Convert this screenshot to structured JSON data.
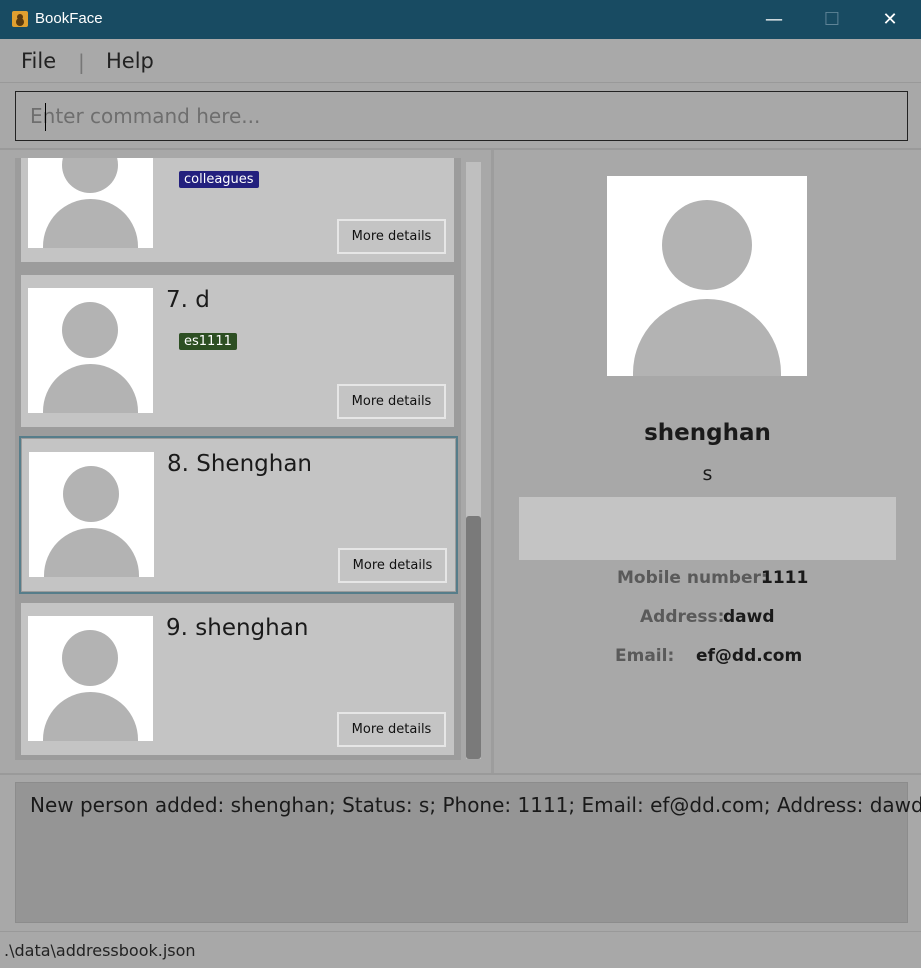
{
  "window": {
    "title": "BookFace",
    "minimize": "—",
    "maximize": "☐",
    "close": "✕"
  },
  "menu": {
    "file": "File",
    "separator": "|",
    "help": "Help"
  },
  "command": {
    "placeholder": "Enter command here...",
    "value": ""
  },
  "list": {
    "cards": [
      {
        "name": "",
        "tag": "colleagues",
        "tag_color": "#23207e",
        "button": "More details"
      },
      {
        "name": "7. d",
        "tag": "es1111",
        "tag_color": "#2d4f23",
        "button": "More details"
      },
      {
        "name": "8. Shenghan",
        "tag": "",
        "button": "More details",
        "selected": true
      },
      {
        "name": "9. shenghan",
        "tag": "",
        "button": "More details"
      }
    ]
  },
  "detail": {
    "name": "shenghan",
    "status": "s",
    "mobile_label": "Mobile number:",
    "mobile": "1111",
    "address_label": "Address:",
    "address": "dawd",
    "email_label": "Email:",
    "email": "ef@dd.com"
  },
  "result": {
    "text": "New person added: shenghan; Status: s; Phone: 1111; Email: ef@dd.com; Address: dawd"
  },
  "status_bar": {
    "path": ".\\data\\addressbook.json"
  },
  "colors": {
    "titlebar": "#184b62",
    "background": "#a8a8a8",
    "card": "#c4c4c4",
    "selected_outline": "#567d8a"
  }
}
